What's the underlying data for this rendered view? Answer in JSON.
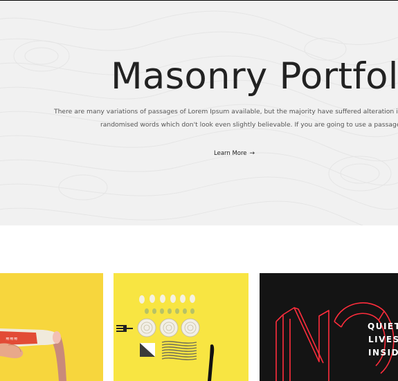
{
  "hero": {
    "title": "Masonry Portfolio",
    "description_line1": "There are many variations of passages of Lorem Ipsum available, but the majority have suffered alteration in some form, by",
    "description_line2": "randomised words which don't look even slightly believable. If you are going to use a passage of Lorem Ipsum",
    "learn_more": "Learn More",
    "learn_more_icon": "arrow-right-icon"
  },
  "portfolio": {
    "items": [
      {
        "name": "hand-with-bottle-image",
        "background": "#f7d63d"
      },
      {
        "name": "food-flatlay-image",
        "background": "#f8e542"
      },
      {
        "name": "neon-sign-image",
        "background": "#141414",
        "sign_text": [
          "QUIET",
          "LIVES",
          "INSIDE"
        ],
        "neon_color": "#ff2d3c"
      }
    ]
  }
}
